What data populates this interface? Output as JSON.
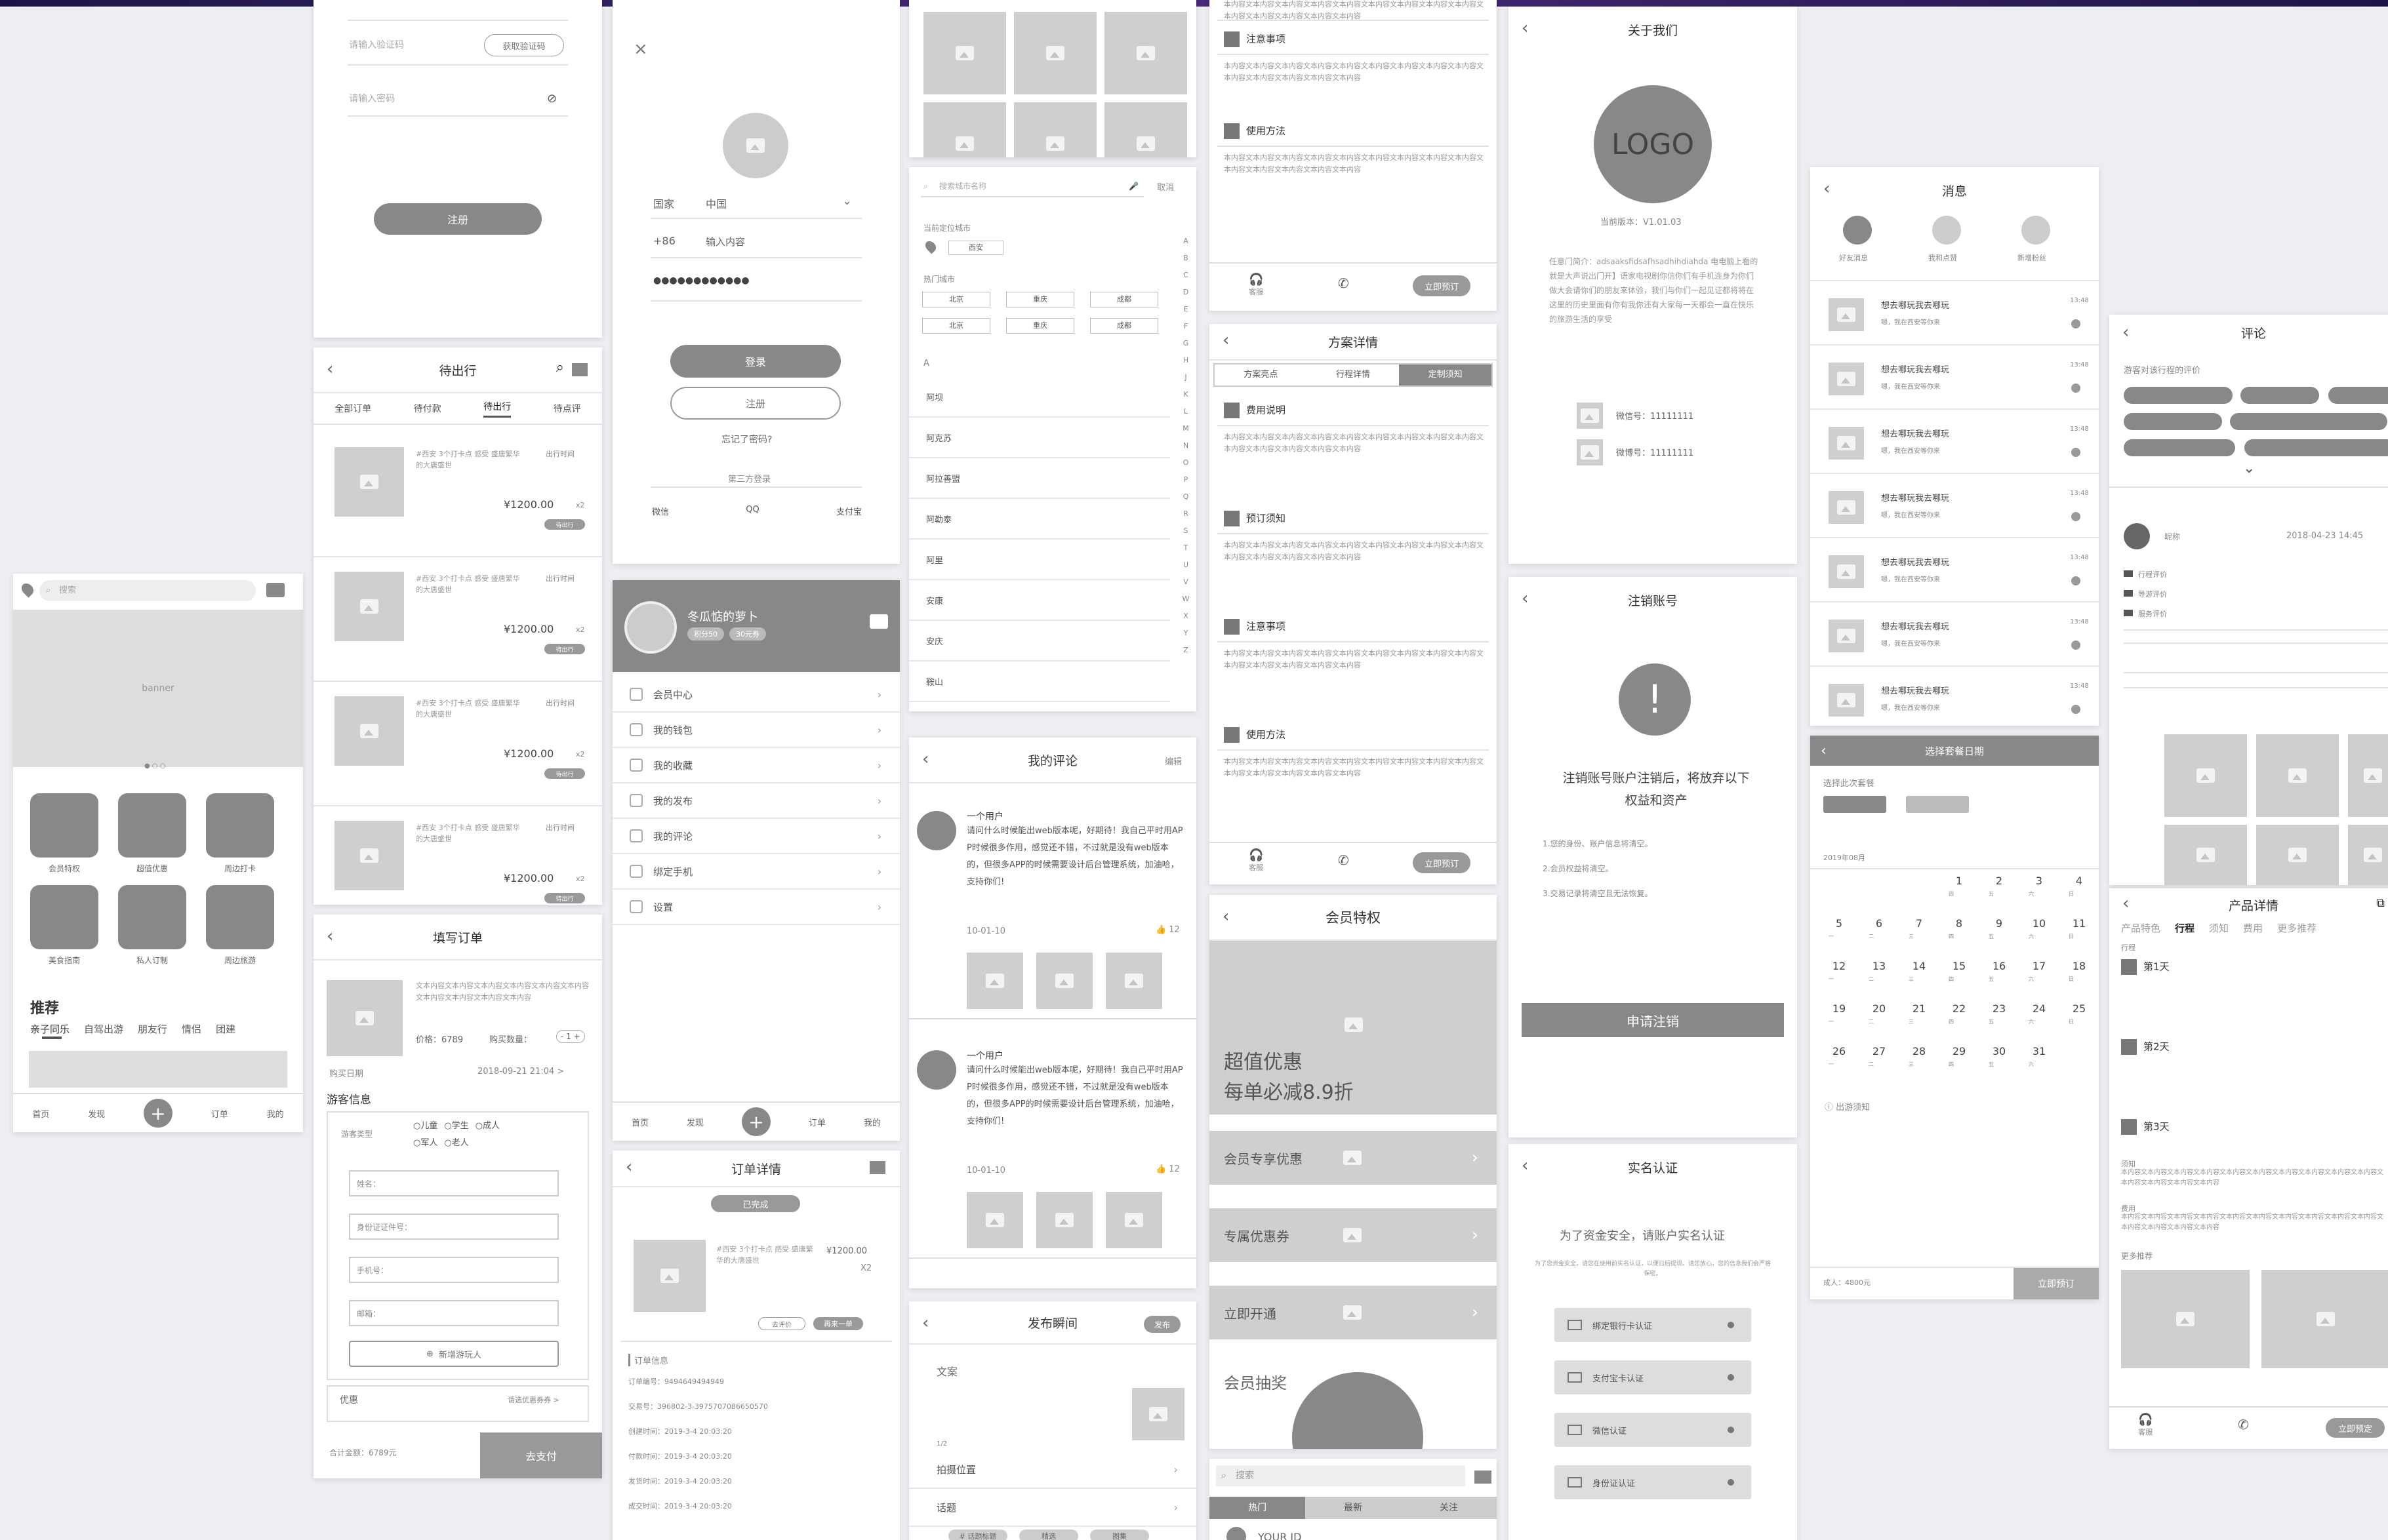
{
  "colors": {
    "frame_bg": "#eceef2",
    "wire_dark": "#888888",
    "wire_light": "#cfcfcf",
    "top_gradient": "#1c1546"
  },
  "home": {
    "search_placeholder": "搜索",
    "banner": "banner",
    "icons": [
      "会员特权",
      "超值优惠",
      "周边打卡",
      "美食指南",
      "私人订制",
      "周边旅游"
    ],
    "section": "推荐",
    "tabs": [
      "亲子同乐",
      "自驾出游",
      "朋友行",
      "情侣",
      "团建"
    ],
    "nav": [
      "首页",
      "发现",
      "订单",
      "我的"
    ]
  },
  "register": {
    "code_placeholder": "请输入验证码",
    "get_code": "获取验证码",
    "pwd_placeholder": "请输入密码",
    "submit": "注册"
  },
  "orders": {
    "title": "待出行",
    "tabs": [
      "全部订单",
      "待付款",
      "待出行",
      "待点评"
    ],
    "item_title": "#西安 3个打卡点 感受 盛唐繁华的大唐盛世",
    "item_time": "出行时间",
    "price": "¥1200.00",
    "qty": "x2",
    "badge": "待出行",
    "count": 4
  },
  "fill": {
    "title": "填写订单",
    "desc": "文本内容文本内容文本内容文本内容文本内容文本内容文本内容文本内容文本内容文本内容",
    "price_label": "价格：6789",
    "qty_label": "购买数量：",
    "stepper": "- 1 +",
    "date_label": "购买日期",
    "date_value": "2018-09-21 21:04 >",
    "section": "游客信息",
    "type_label": "游客类型",
    "types": [
      "○儿童",
      "○学生",
      "○成人",
      "○军人",
      "○老人"
    ],
    "fields": [
      "姓名：",
      "身份证证件号：",
      "手机号：",
      "邮箱："
    ],
    "add": "新增游玩人",
    "discount": "优惠",
    "discount_val": "请选优惠券券 >",
    "total": "合计金额：6789元",
    "pay": "去支付"
  },
  "login": {
    "country_label": "国家",
    "country": "中国",
    "code": "+86",
    "phone_placeholder": "输入内容",
    "password": "●●●●●●●●●●●●",
    "login": "登录",
    "register": "注册",
    "forgot": "忘记了密码?",
    "third": "第三方登录",
    "third_list": [
      "微信",
      "QQ",
      "支付宝"
    ]
  },
  "profile": {
    "name": "冬瓜惦的萝卜",
    "tags": [
      "积分50",
      "30元券"
    ],
    "menu": [
      "会员中心",
      "我的钱包",
      "我的收藏",
      "我的发布",
      "我的评论",
      "绑定手机",
      "设置"
    ],
    "nav": [
      "首页",
      "发现",
      "订单",
      "我的"
    ]
  },
  "order_detail": {
    "title": "订单详情",
    "status": "已完成",
    "item": "#西安 3个打卡点 感受 盛唐繁华的大唐盛世",
    "price": "¥1200.00",
    "qty": "X2",
    "btn1": "去评价",
    "btn2": "再来一单",
    "info_title": "订单信息",
    "info": [
      "订单编号：9494649494949",
      "交易号：396802-3-3975707086650570",
      "创建时间：2019-3-4 20:03:20",
      "付款时间：2019-3-4 20:03:20",
      "发货时间：2019-3-4 20:03:20",
      "成交时间：2019-3-4 20:03:20"
    ]
  },
  "city": {
    "search_placeholder": "搜索城市名称",
    "cancel": "取消",
    "located_label": "当前定位城市",
    "located": "西安",
    "hot_label": "热门城市",
    "hot": [
      "北京",
      "重庆",
      "成都",
      "北京",
      "重庆",
      "成都"
    ],
    "letter": "A",
    "list": [
      "阿坝",
      "阿克苏",
      "阿拉善盟",
      "阿勒泰",
      "阿里",
      "安康",
      "安庆",
      "鞍山"
    ],
    "index": [
      "A",
      "B",
      "C",
      "D",
      "E",
      "F",
      "G",
      "H",
      "J",
      "K",
      "L",
      "M",
      "N",
      "O",
      "P",
      "Q",
      "R",
      "S",
      "T",
      "U",
      "V",
      "W",
      "X",
      "Y",
      "Z"
    ]
  },
  "comments": {
    "title": "我的评论",
    "edit": "编辑",
    "user": "一个用户",
    "text": "请问什么时候能出web版本呢，好期待！我自己平时用APP时候很多作用，感觉还不错，不过就是没有web版本的，但很多APP的时候需要设计后台管理系统，加油哈，支持你们!",
    "date": "10-01-10",
    "likes": "12"
  },
  "post": {
    "title": "发布瞬间",
    "publish": "发布",
    "label": "文案",
    "count": "1/2",
    "location": "拍摄位置",
    "topic": "话题",
    "tags": [
      "# 话题标题",
      "精选",
      "图集"
    ]
  },
  "notes": {
    "items": [
      "注意事项",
      "使用方法"
    ],
    "text": "本内容文本内容文本内容文本内容文本内容文本内容文本内容文本内容文本内容文本内容文本内容文本内容文本内容文本内容",
    "service": "客服",
    "book": "立即预订"
  },
  "plan": {
    "title": "方案详情",
    "tabs": [
      "方案亮点",
      "行程详情",
      "定制须知"
    ],
    "sections": [
      "费用说明",
      "预订须知",
      "注意事项",
      "使用方法"
    ],
    "text": "本内容文本内容文本内容文本内容文本内容文本内容文本内容文本内容文本内容文本内容文本内容文本内容文本内容文本内容",
    "service": "客服",
    "book": "立即预订"
  },
  "vip": {
    "title": "会员特权",
    "slogan1": "超值优惠",
    "slogan2": "每单必减8.9折",
    "rows": [
      "会员专享优惠",
      "专属优惠券",
      "立即开通"
    ],
    "lottery": "会员抽奖"
  },
  "discover": {
    "search_placeholder": "搜索",
    "tabs": [
      "热门",
      "最新",
      "关注"
    ],
    "user": "YOUR ID"
  },
  "about": {
    "title": "关于我们",
    "logo": "LOGO",
    "version": "当前版本：V1.01.03",
    "intro": "任意门简介：adsaaksfidsafhsadhihdiahda 电电脑上看的就是大声说出门开】语家电视剧你信你们有手机连身为你们做大会请你们的朋友来体验，我们与你们一起见证都将将在这里的历史里面有你有我你还有大家每一天都会一直在快乐的旅游生活的享受",
    "wechat": "微信号：11111111",
    "weibo": "微博号：11111111"
  },
  "cancel_acc": {
    "title": "注销账号",
    "mark": "!",
    "headline": "注销账号账户注销后，将放弃以下权益和资产",
    "items": [
      "1.您的身份、账户信息将清空。",
      "2.会员权益将清空。",
      "3.交易记录将清空且无法恢复。"
    ],
    "apply": "申请注销"
  },
  "realname": {
    "title": "实名认证",
    "headline": "为了资金安全，请账户实名认证",
    "sub": "为了您资金安全，请您在使用前实名认证，以便日后提现。请您放心，您的信息我们会严格保密。",
    "items": [
      "绑定银行卡认证",
      "支付宝卡认证",
      "微信认证",
      "身份证认证"
    ]
  },
  "messages": {
    "title": "消息",
    "types": [
      "好友消息",
      "我和点赞",
      "新增粉丝"
    ],
    "item_title": "想去哪玩我去哪玩",
    "item_sub": "嗯，我在西安等你来",
    "time": "13:48",
    "count": 7
  },
  "calendar": {
    "title": "选择套餐日期",
    "pkg_label": "选择此次套餐",
    "month": "2019年08月",
    "week": [
      "一",
      "二",
      "三",
      "四",
      "五",
      "六",
      "日"
    ],
    "days": [
      "1",
      "2",
      "3",
      "4",
      "5",
      "6",
      "7",
      "8",
      "9",
      "10",
      "11",
      "12",
      "13",
      "14",
      "15",
      "16",
      "17",
      "18",
      "19",
      "20",
      "21",
      "22",
      "23",
      "24",
      "25",
      "26",
      "27",
      "28",
      "29",
      "30",
      "31"
    ],
    "tip": "出游须知",
    "total": "成人：4800元",
    "confirm": "立即预订"
  },
  "review": {
    "title": "评论",
    "headline": "游客对该行程的评价",
    "user": "昵称",
    "date": "2018-04-23 14:45",
    "scores": [
      "行程评价",
      "导游评价",
      "服务评价"
    ]
  },
  "product": {
    "title": "产品详情",
    "tabs": [
      "产品特色",
      "行程",
      "须知",
      "费用",
      "更多推荐"
    ],
    "trip_label": "行程",
    "days": [
      "第1天",
      "第2天",
      "第3天"
    ],
    "notes_label": "须知",
    "fee_label": "费用",
    "more_label": "更多推荐",
    "book": "立即预定",
    "service": "客服"
  }
}
